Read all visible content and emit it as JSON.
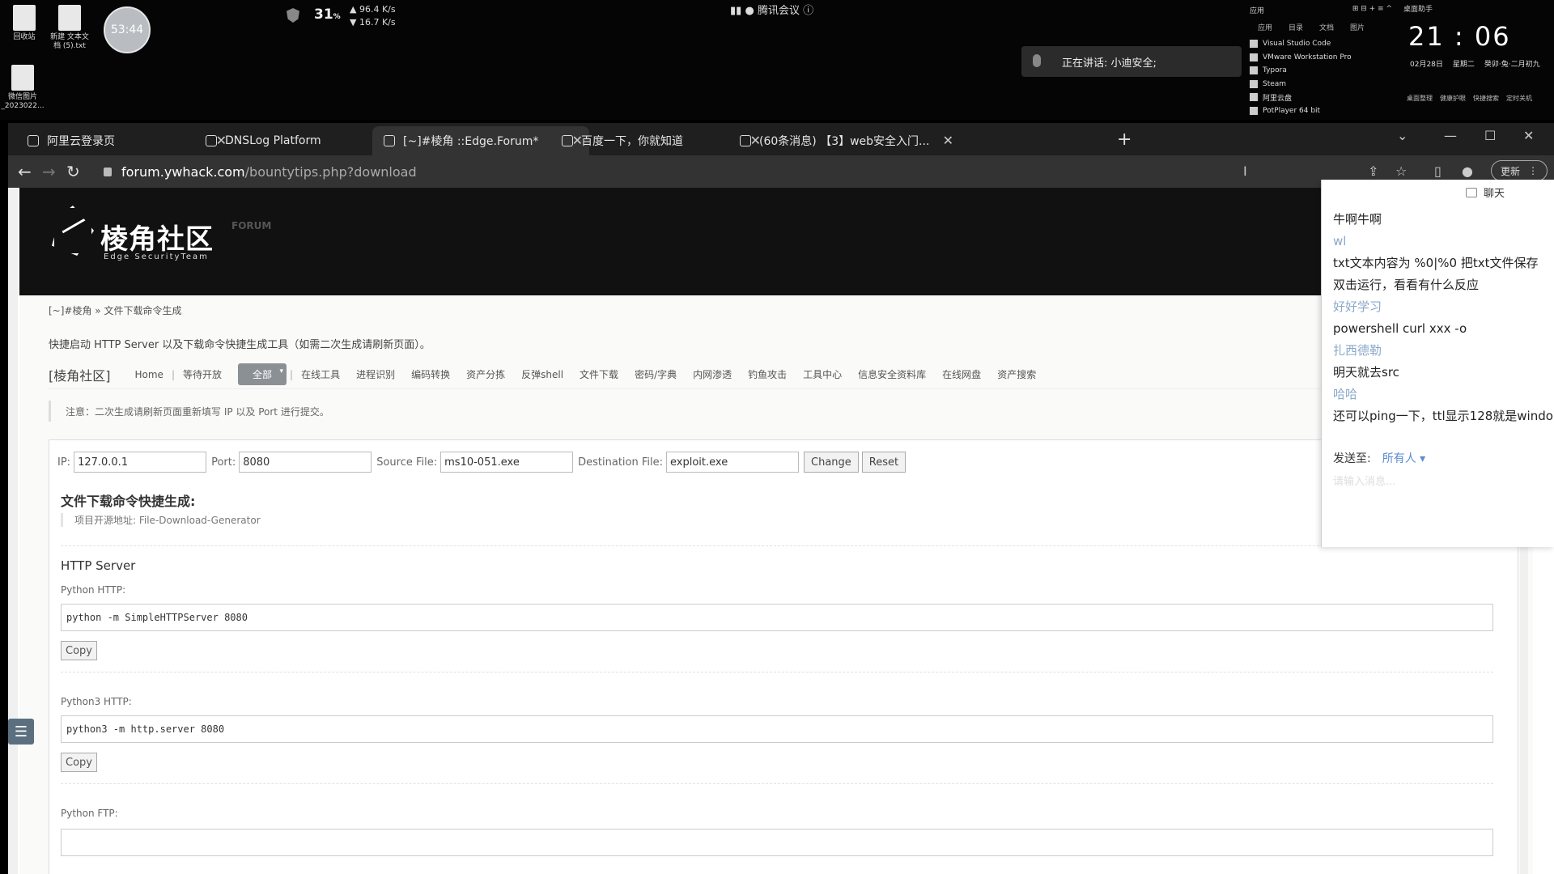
{
  "desktop": {
    "icons": [
      {
        "label": "回收站"
      },
      {
        "label": "新建 文本文档 (5).txt"
      },
      {
        "label": "微信图片_2023022..."
      }
    ],
    "timer": "53:44",
    "net": {
      "cpu_pct": "31",
      "pct_unit": "%",
      "down": "▲ 96.4 K/s",
      "up": "▼ 16.7 K/s"
    },
    "meeting_title": "腾讯会议",
    "speaking": "正在讲话: 小迪安全;",
    "apps": {
      "header": "应用",
      "tabs": [
        "应用",
        "目录",
        "文档",
        "图片"
      ],
      "items": [
        "Visual Studio Code",
        "VMware Workstation Pro",
        "Typora",
        "Steam",
        "阿里云盘",
        "PotPlayer 64 bit"
      ]
    },
    "clock": {
      "label": "桌面助手",
      "time": "21 : 06",
      "date": "02月28日",
      "weekday": "星期二",
      "lunar": "癸卯·兔·二月初九",
      "tools": [
        "桌面整理",
        "健康护眼",
        "快捷搜索",
        "定时关机"
      ]
    }
  },
  "browser": {
    "tabs": [
      {
        "title": "阿里云登录页"
      },
      {
        "title": "DNSLog Platform"
      },
      {
        "title": "[~]#棱角 ::Edge.Forum*"
      },
      {
        "title": "百度一下，你就知道"
      },
      {
        "title": "(60条消息) 【3】web安全入门..."
      }
    ],
    "url_host": "forum.ywhack.com",
    "url_path": "/bountytips.php?download",
    "update_label": "更新"
  },
  "site": {
    "logo_text": "棱角社区",
    "logo_sub": "Edge SecurityTeam",
    "logo_forum": "FORUM",
    "breadcrumb": "[~]#棱角 » 文件下载命令生成",
    "intro": "快捷启动 HTTP Server 以及下载命令快捷生成工具（如需二次生成请刷新页面）。",
    "nav": {
      "brand": "[棱角社区]",
      "links": [
        "Home",
        "等待开放"
      ],
      "all_menu": "全部",
      "items": [
        "在线工具",
        "进程识别",
        "编码转换",
        "资产分拣",
        "反弹shell",
        "文件下载",
        "密码/字典",
        "内网渗透",
        "钓鱼攻击",
        "工具中心",
        "信息安全资料库",
        "在线网盘",
        "资产搜索"
      ]
    },
    "notice": "注意：二次生成请刷新页面重新填写 IP 以及 Port 进行提交。",
    "form": {
      "ip_label": "IP:",
      "ip_value": "127.0.0.1",
      "port_label": "Port:",
      "port_value": "8080",
      "src_label": "Source File:",
      "src_value": "ms10-051.exe",
      "dst_label": "Destination File:",
      "dst_value": "exploit.exe",
      "change": "Change",
      "reset": "Reset"
    },
    "section_title": "文件下载命令快捷生成:",
    "source_line": "项目开源地址: File-Download-Generator",
    "http_server": "HTTP Server",
    "blocks": [
      {
        "label": "Python HTTP:",
        "cmd": "python -m SimpleHTTPServer 8080",
        "copy": "Copy"
      },
      {
        "label": "Python3 HTTP:",
        "cmd": "python3 -m http.server 8080",
        "copy": "Copy"
      },
      {
        "label": "Python FTP:"
      }
    ]
  },
  "chat": {
    "title": "聊天",
    "messages": [
      {
        "type": "text",
        "value": "牛啊牛啊"
      },
      {
        "type": "sender",
        "value": "wl"
      },
      {
        "type": "text",
        "value": "txt文本内容为 %0|%0    把txt文件保存"
      },
      {
        "type": "text",
        "value": "双击运行，看看有什么反应"
      },
      {
        "type": "sender",
        "value": "好好学习"
      },
      {
        "type": "text",
        "value": "powershell curl xxx -o"
      },
      {
        "type": "sender",
        "value": "扎西德勒"
      },
      {
        "type": "text",
        "value": "明天就去src"
      },
      {
        "type": "sender",
        "value": "哈哈"
      },
      {
        "type": "text",
        "value": "还可以ping一下，ttl显示128就是windo"
      }
    ],
    "send_to_label": "发送至:",
    "send_to_value": "所有人 ▾",
    "input_placeholder": "请输入消息..."
  }
}
